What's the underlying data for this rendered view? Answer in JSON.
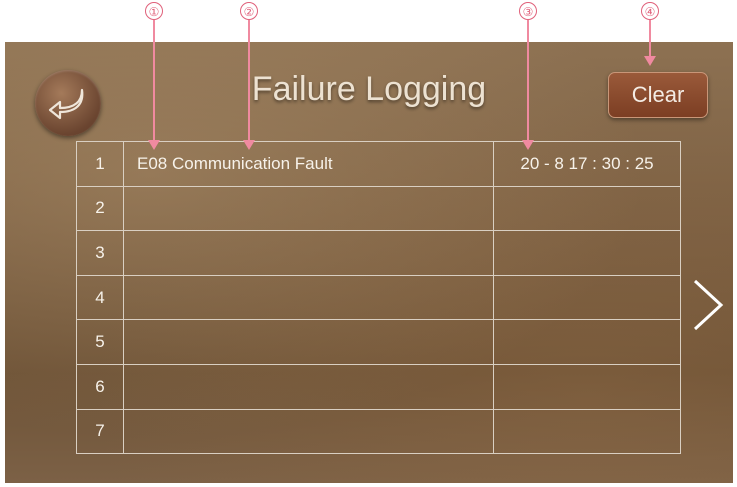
{
  "callouts": [
    "①",
    "②",
    "③",
    "④"
  ],
  "header": {
    "title": "Failure Logging",
    "clear_label": "Clear"
  },
  "log_rows": [
    {
      "index": "1",
      "code_desc": "E08  Communication Fault",
      "time": "20 - 8  17 : 30 : 25"
    },
    {
      "index": "2",
      "code_desc": "",
      "time": ""
    },
    {
      "index": "3",
      "code_desc": "",
      "time": ""
    },
    {
      "index": "4",
      "code_desc": "",
      "time": ""
    },
    {
      "index": "5",
      "code_desc": "",
      "time": ""
    },
    {
      "index": "6",
      "code_desc": "",
      "time": ""
    },
    {
      "index": "7",
      "code_desc": "",
      "time": ""
    }
  ],
  "icons": {
    "back": "back-arrow-icon",
    "next": "chevron-right-icon"
  },
  "colors": {
    "callout": "#e0607a",
    "clear_button": "#8a4a2d",
    "grid_lines": "#d9cfc2"
  }
}
